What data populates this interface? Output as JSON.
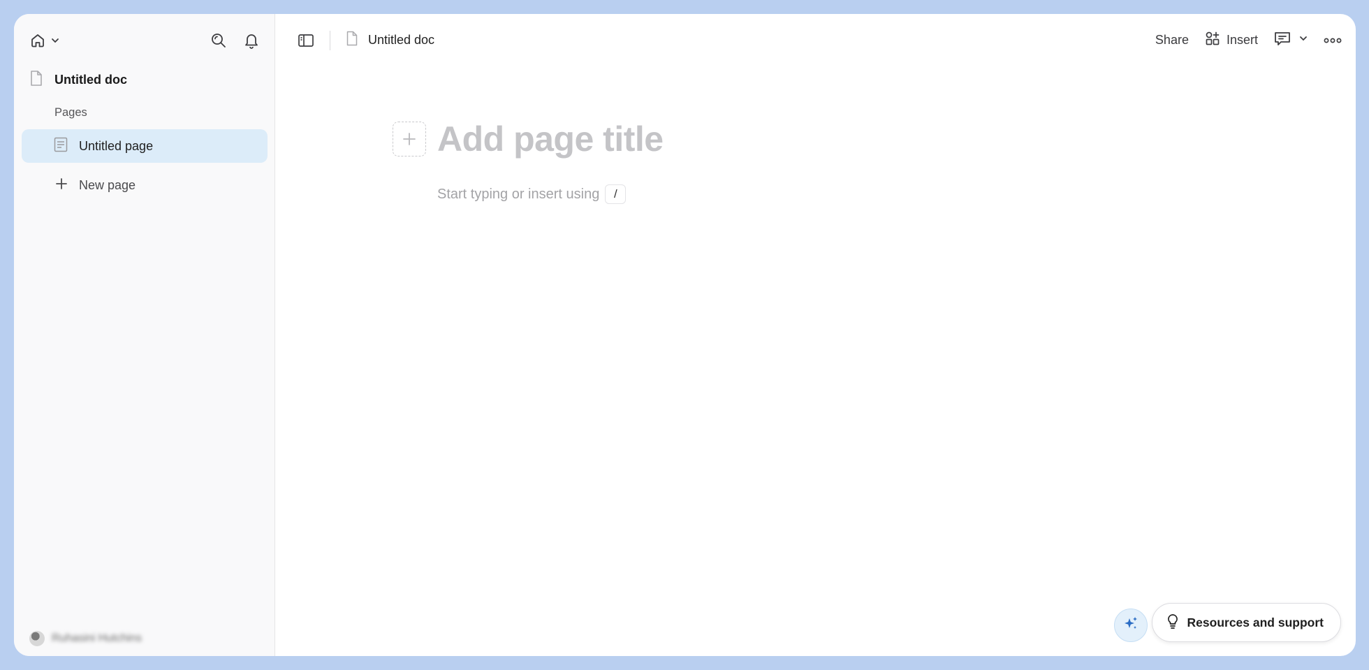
{
  "sidebar": {
    "doc_title": "Untitled doc",
    "section_label": "Pages",
    "pages": [
      {
        "label": "Untitled page"
      }
    ],
    "new_page_label": "New page",
    "user_name": "Ruhasini Hutchins"
  },
  "topbar": {
    "doc_title": "Untitled doc",
    "share_label": "Share",
    "insert_label": "Insert"
  },
  "editor": {
    "title_placeholder": "Add page title",
    "body_placeholder": "Start typing or insert using",
    "slash_key": "/"
  },
  "footer": {
    "resources_label": "Resources and support"
  },
  "colors": {
    "frame": "#b9cff0",
    "sidebar_bg": "#f9f9fa",
    "selected_page_bg": "#dcecf9",
    "ai_accent": "#2a6cc4"
  }
}
